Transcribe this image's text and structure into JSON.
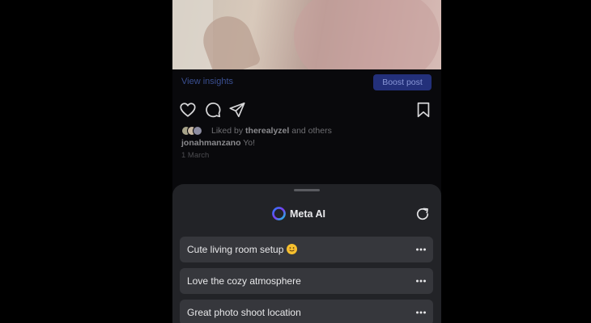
{
  "post": {
    "view_insights": "View insights",
    "boost_post": "Boost post",
    "liked_by_prefix": "Liked by ",
    "liked_by_user": "therealyzel",
    "liked_by_suffix": " and others",
    "caption_user": "jonahmanzano",
    "caption_text": " Yo!",
    "date": "1 March",
    "icons": [
      "heart-icon",
      "comment-icon",
      "share-icon",
      "bookmark-icon"
    ]
  },
  "meta_ai": {
    "title": "Meta AI",
    "icons": [
      "meta-ai-logo",
      "refresh-icon",
      "more-icon"
    ],
    "suggestions": [
      {
        "text": "Cute living room setup",
        "emoji": "😊"
      },
      {
        "text": "Love the cozy atmosphere",
        "emoji": ""
      },
      {
        "text": "Great photo shoot location",
        "emoji": ""
      }
    ]
  },
  "colors": {
    "background": "#000000",
    "sheet": "#222327",
    "suggestion": "#36373c",
    "boost_button": "#23307a",
    "link": "#3a4f91"
  }
}
